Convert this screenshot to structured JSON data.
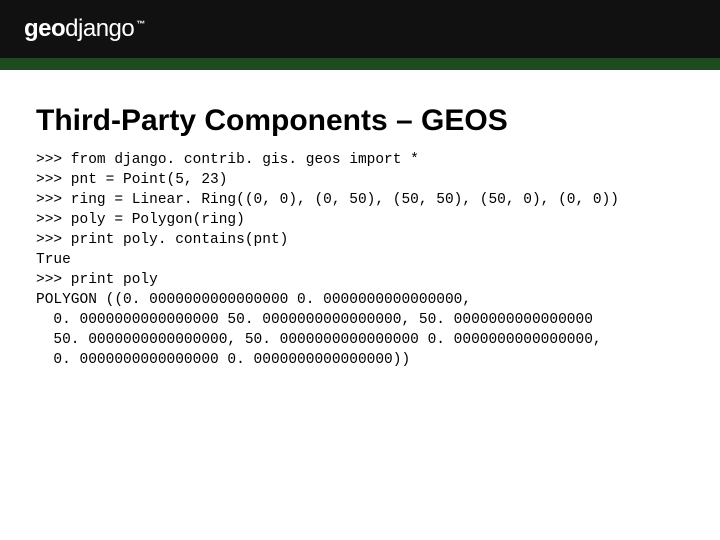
{
  "header": {
    "logo_geo": "geo",
    "logo_django": "django",
    "logo_tm": "™"
  },
  "slide": {
    "title": "Third-Party Components – GEOS",
    "code": ">>> from django. contrib. gis. geos import *\n>>> pnt = Point(5, 23)\n>>> ring = Linear. Ring((0, 0), (0, 50), (50, 50), (50, 0), (0, 0))\n>>> poly = Polygon(ring)\n>>> print poly. contains(pnt)\nTrue\n>>> print poly\nPOLYGON ((0. 0000000000000000 0. 0000000000000000,\n  0. 0000000000000000 50. 0000000000000000, 50. 0000000000000000\n  50. 0000000000000000, 50. 0000000000000000 0. 0000000000000000,\n  0. 0000000000000000 0. 0000000000000000))"
  }
}
